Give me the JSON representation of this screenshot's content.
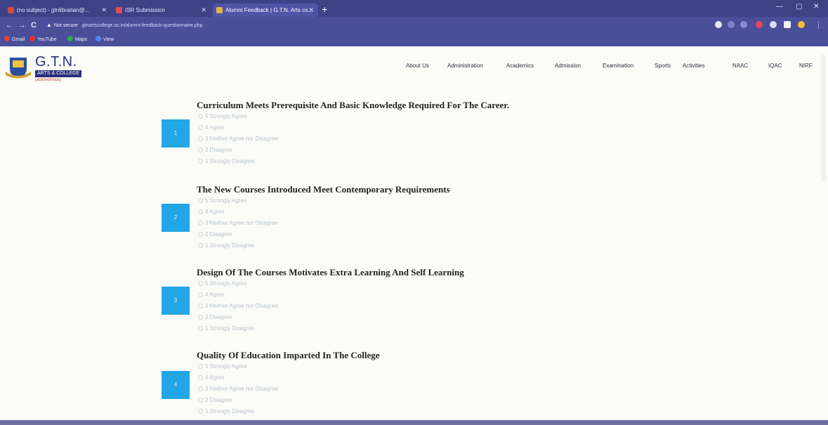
{
  "browser": {
    "tabs": [
      {
        "label": "(no subject) - gtnlibrarian@...",
        "favicon_color": "#d54b3d"
      },
      {
        "label": "ISR Submission",
        "favicon_color": "#e04b5a"
      },
      {
        "label": "Alumni Feedback | G.T.N. Arts co...",
        "favicon_color": "#e0b540"
      }
    ],
    "new_tab": "+",
    "window_controls": [
      "—",
      "▢",
      "✕"
    ],
    "nav": {
      "back": "←",
      "forward": "→",
      "reload": "C"
    },
    "security_warning": "▲",
    "security_label": "Not secure",
    "url": "gtnartscollege.ac.in/alumni-feedback-questionnaire.php",
    "bookmarks": [
      {
        "label": "Gmail",
        "color": "#db4437"
      },
      {
        "label": "YouTube",
        "color": "#e0322a"
      },
      {
        "label": "Maps",
        "color": "#34a853"
      },
      {
        "label": "View",
        "color": "#4d88f0"
      }
    ]
  },
  "site": {
    "logo": {
      "title": "G.T.N.",
      "subtitle": "ARTS & COLLEGE",
      "autonomous": "(autonomous)"
    },
    "nav": [
      "About Us",
      "Administration",
      "Academics",
      "Admission",
      "Examination",
      "Sports",
      "Activities",
      "NAAC",
      "IQAC",
      "NIRF"
    ]
  },
  "questions": [
    {
      "number": "1",
      "title": "Curriculum Meets Prerequisite And Basic Knowledge Required For The Career.",
      "options": [
        "5 Strongly Agree",
        "4 Agree",
        "3 Neither Agree nor Disagree",
        "2 Disagree",
        "1 Strongly Disagree"
      ]
    },
    {
      "number": "2",
      "title": "The New Courses Introduced Meet Contemporary Requirements",
      "options": [
        "5 Strongly Agree",
        "4 Agree",
        "3 Neither Agree nor Disagree",
        "2 Disagree",
        "1 Strongly Disagree"
      ]
    },
    {
      "number": "3",
      "title": "Design Of The Courses Motivates Extra Learning And Self Learning",
      "options": [
        "5 Strongly Agree",
        "4 Agree",
        "3 Neither Agree nor Disagree",
        "2 Disagree",
        "1 Strongly Disagree"
      ]
    },
    {
      "number": "4",
      "title": "Quality Of Education Imparted In The College",
      "options": [
        "5 Strongly Agree",
        "4 Agree",
        "3 Neither Agree nor Disagree",
        "2 Disagree",
        "1 Strongly Disagree"
      ]
    }
  ],
  "colors": {
    "accent": "#23a6e6",
    "chrome": "#4a4f9a"
  }
}
